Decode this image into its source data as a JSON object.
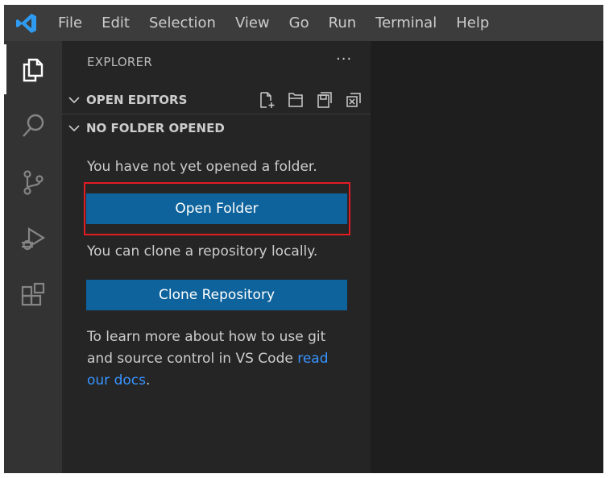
{
  "menu": [
    "File",
    "Edit",
    "Selection",
    "View",
    "Go",
    "Run",
    "Terminal",
    "Help"
  ],
  "activity_bar": [
    "explorer-icon",
    "search-icon",
    "source-control-icon",
    "run-debug-icon",
    "extensions-icon"
  ],
  "sidebar": {
    "title": "EXPLORER",
    "more": "···",
    "open_editors": {
      "label": "OPEN EDITORS",
      "actions": [
        "new-file-icon",
        "new-folder-icon",
        "save-all-icon",
        "close-all-icon"
      ]
    },
    "no_folder": {
      "label": "NO FOLDER OPENED",
      "message": "You have not yet opened a folder.",
      "open_folder": "Open Folder",
      "clone_message": "You can clone a repository locally.",
      "clone_button": "Clone Repository",
      "learn_line1": "To learn more about how to use git",
      "learn_line2": "and source control in VS Code ",
      "link_part1": "read",
      "link_part2": "our docs",
      "period": "."
    }
  },
  "colors": {
    "button": "#0e639c",
    "link": "#3794ff",
    "highlight": "#e31b23",
    "logo": "#2f9bf0"
  }
}
